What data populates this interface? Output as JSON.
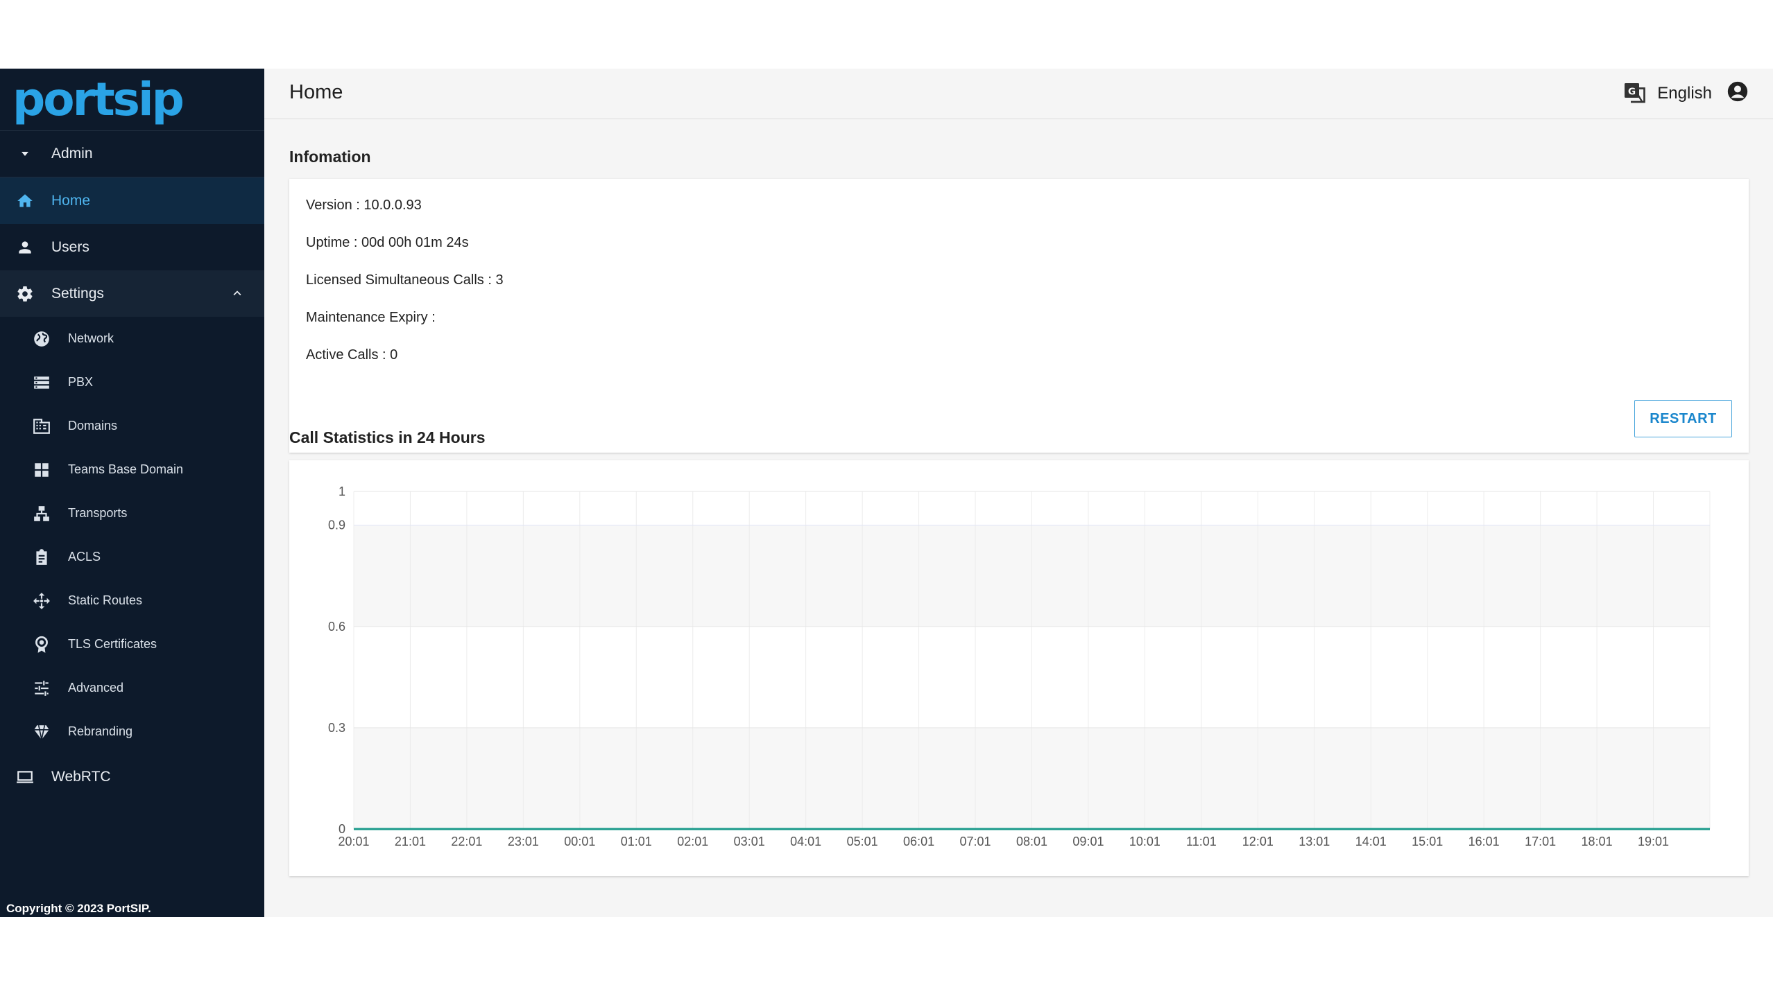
{
  "brand": {
    "logo_text": "portsip",
    "accent": "#2aa3e6"
  },
  "sidebar": {
    "admin_label": "Admin",
    "items": [
      {
        "label": "Home",
        "icon": "home-icon",
        "active": true
      },
      {
        "label": "Users",
        "icon": "user-icon"
      },
      {
        "label": "Settings",
        "icon": "gear-icon",
        "expanded": true
      }
    ],
    "settings_items": [
      {
        "label": "Network",
        "icon": "globe-icon"
      },
      {
        "label": "PBX",
        "icon": "server-list-icon"
      },
      {
        "label": "Domains",
        "icon": "building-icon"
      },
      {
        "label": "Teams Base Domain",
        "icon": "grid-icon"
      },
      {
        "label": "Transports",
        "icon": "hierarchy-icon"
      },
      {
        "label": "ACLS",
        "icon": "clipboard-icon"
      },
      {
        "label": "Static Routes",
        "icon": "move-arrows-icon"
      },
      {
        "label": "TLS Certificates",
        "icon": "certificate-icon"
      },
      {
        "label": "Advanced",
        "icon": "sliders-icon"
      },
      {
        "label": "Rebranding",
        "icon": "diamond-icon"
      }
    ],
    "webrtc_label": "WebRTC",
    "copyright": "Copyright © 2023 PortSIP."
  },
  "header": {
    "title": "Home",
    "language": "English"
  },
  "info": {
    "section_title": "Infomation",
    "version": "Version : 10.0.0.93",
    "uptime": "Uptime : 00d 00h 01m 24s",
    "licensed_calls": "Licensed Simultaneous Calls : 3",
    "maintenance_expiry": "Maintenance Expiry :",
    "active_calls": "Active Calls : 0",
    "restart_label": "RESTART"
  },
  "stats": {
    "section_title": "Call Statistics in 24 Hours"
  },
  "chart_data": {
    "type": "line",
    "title": "",
    "xlabel": "",
    "ylabel": "",
    "x": [
      "20:01",
      "21:01",
      "22:01",
      "23:01",
      "00:01",
      "01:01",
      "02:01",
      "03:01",
      "04:01",
      "05:01",
      "06:01",
      "07:01",
      "08:01",
      "09:01",
      "10:01",
      "11:01",
      "12:01",
      "13:01",
      "14:01",
      "15:01",
      "16:01",
      "17:01",
      "18:01",
      "19:01"
    ],
    "series": [
      {
        "values": [
          0,
          0,
          0,
          0,
          0,
          0,
          0,
          0,
          0,
          0,
          0,
          0,
          0,
          0,
          0,
          0,
          0,
          0,
          0,
          0,
          0,
          0,
          0,
          0,
          0
        ],
        "color": "#1a9a8a"
      }
    ],
    "y_ticks": [
      0,
      0.3,
      0.6,
      0.9,
      1
    ],
    "ylim": [
      0,
      1
    ],
    "grid": true,
    "band_colors": [
      "#ffffff",
      "#f7f7f7"
    ]
  }
}
